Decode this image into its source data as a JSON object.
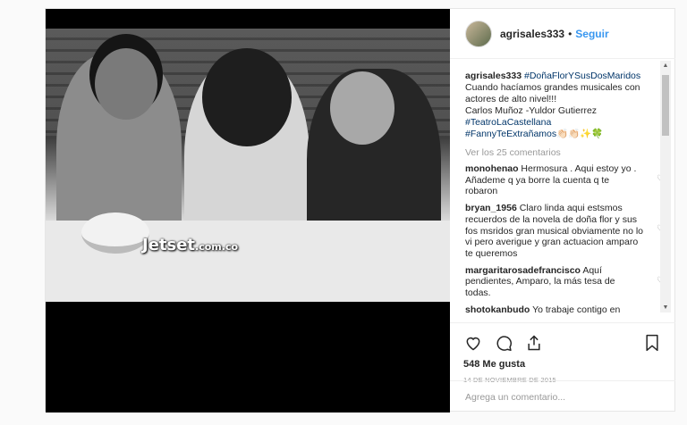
{
  "post": {
    "username": "agrisales333",
    "follow_label": "Seguir",
    "separator": "•",
    "watermark_brand": "Jetset",
    "watermark_domain": ".com.co",
    "caption": {
      "username": "agrisales333",
      "tag1": "#DoñaFlorYSusDosMaridos",
      "line1": "Cuando hacíamos grandes musicales con actores de alto nivel!!!",
      "line2": "Carlos Muñoz -Yuldor Gutierrez",
      "tag2": "#TeatroLaCastellana",
      "tag3": "#FannyTeExtrañamos",
      "emoji": "👏🏻👏🏻✨🍀"
    },
    "view_comments": "Ver los 25 comentarios",
    "comments": [
      {
        "user": "monohenao",
        "text": "Hermosura . Aqui estoy yo . Añademe q ya borre la cuenta q te robaron"
      },
      {
        "user": "bryan_1956",
        "text": "Claro linda aqui estsmos recuerdos de la novela de doña flor y sus fos msridos gran musical obviamente no lo vi pero averigue y gran actuacion amparo te queremos"
      },
      {
        "user": "margaritarosadefrancisco",
        "text": "Aquí pendientes, Amparo, la más tesa de todas."
      },
      {
        "user": "shotokanbudo",
        "text": "Yo trabaje contigo en"
      }
    ],
    "likes": "548 Me gusta",
    "date": "14 DE NOVIEMBRE DE 2015",
    "add_comment_placeholder": "Agrega un comentario..."
  },
  "icons": [
    "heart-icon",
    "comment-icon",
    "share-icon",
    "bookmark-icon"
  ]
}
